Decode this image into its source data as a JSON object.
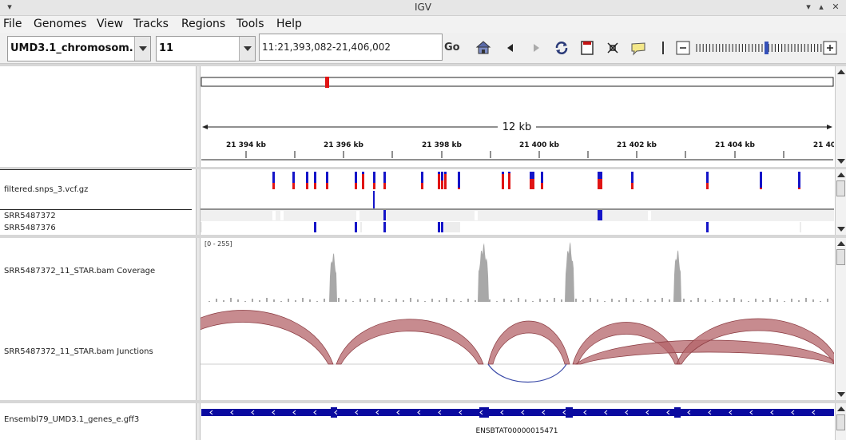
{
  "window": {
    "title": "IGV"
  },
  "menubar": {
    "items": [
      {
        "label": "File",
        "key": "file"
      },
      {
        "label": "Genomes",
        "key": "genomes"
      },
      {
        "label": "View",
        "key": "view"
      },
      {
        "label": "Tracks",
        "key": "tracks"
      },
      {
        "label": "Regions",
        "key": "regions"
      },
      {
        "label": "Tools",
        "key": "tools"
      },
      {
        "label": "Help",
        "key": "help"
      }
    ]
  },
  "toolbar": {
    "genome": "UMD3.1_chromosom...",
    "chromosome": "11",
    "locus": "11:21,393,082-21,406,002",
    "go_label": "Go"
  },
  "ruler": {
    "span_label": "12 kb",
    "ticks": [
      "21 394 kb",
      "21 396 kb",
      "21 398 kb",
      "21 400 kb",
      "21 402 kb",
      "21 404 kb",
      "21 40"
    ]
  },
  "tracks": {
    "vcf_name": "filtered.snps_3.vcf.gz",
    "sample1_name": "SRR5487372",
    "sample2_name": "SRR5487376",
    "coverage_name": "SRR5487372_11_STAR.bam Coverage",
    "coverage_range": "[0 - 255]",
    "junctions_name": "SRR5487372_11_STAR.bam Junctions",
    "gene_track_name": "Ensembl79_UMD3.1_genes_e.gff3",
    "gene_label": "ENSBTAT00000015471"
  },
  "colors": {
    "variant_blue": "#1414c8",
    "variant_red": "#e01414",
    "coverage_gray": "#a8a8a8",
    "junction_red": "#b4646a",
    "junction_blue": "#3a4aa8",
    "gene_blue": "#0a0aa0"
  }
}
